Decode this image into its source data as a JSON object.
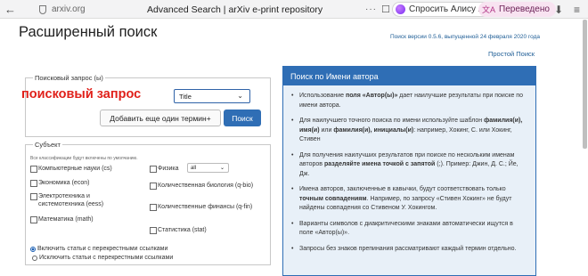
{
  "browser": {
    "back": "←",
    "url": "arxiv.org",
    "title": "Advanced Search | arXiv e-print repository",
    "dots": "···",
    "bookmark": "☐",
    "alice": "Спросить Алису AI",
    "translated": "Переведено",
    "download": "⬇",
    "menu": "≡"
  },
  "page": {
    "title": "Расширенный поиск",
    "version": "Поиск версии 0.5.6, выпущенной 24 февраля 2020 года",
    "simple_link": "Простой Поиск"
  },
  "query": {
    "legend": "Поисковый запрос (ы)",
    "annotation": "поисковый запрос",
    "field_value": "Title",
    "add_term": "Добавить еще один термин+",
    "search": "Поиск"
  },
  "subject": {
    "legend": "Субъект",
    "note": "Все классификации будут включены по умолчанию.",
    "cs": "Компьютерные науки (cs)",
    "econ": "Экономика (econ)",
    "eess": "Электротехника и системотехника (eess)",
    "math": "Математика (math)",
    "physics": "Физика",
    "physics_select": "all",
    "qbio": "Количественная биология (q-bio)",
    "qfin": "Количественные финансы (q-fin)",
    "stat": "Статистика (stat)",
    "radio_include": "Включить статьи с перекрестными ссылками",
    "radio_exclude": "Исключить статьи с перекрестными ссылками"
  },
  "help": {
    "header": "Поиск по Имени автора",
    "items": [
      {
        "pre": "Использование ",
        "b1": "поля «Автор(ы)»",
        "mid": " дает наилучшие результаты при поиске по имени автора.",
        "b2": "",
        "post": ""
      },
      {
        "pre": "Для наилучшего точного поиска по имени используйте шаблон ",
        "b1": "фамилия(и), имя(и)",
        "mid": " или ",
        "b2": "фамилия(и), инициалы(и)",
        "post": ": например, Хокинг, С. или Хокинг, Стивен"
      },
      {
        "pre": "Для получения наилучших результатов при поиске по нескольким именам авторов ",
        "b1": "разделяйте имена точкой с запятой",
        "mid": " (;). Пример: Джин, Д. С.; Йе, Дж.",
        "b2": "",
        "post": ""
      },
      {
        "pre": "Имена авторов, заключенные в кавычки, будут соответствовать только ",
        "b1": "точным совпадениям",
        "mid": ". Например, по запросу «Стивен Хокинг» не будут найдены совпадения со Стивеном У. Хокингом.",
        "b2": "",
        "post": ""
      },
      {
        "pre": "Варианты символов с диакритическими знаками автоматически ищутся в поле «Автор(ы)».",
        "b1": "",
        "mid": "",
        "b2": "",
        "post": ""
      },
      {
        "pre": "Запросы без знаков препинания рассматривают каждый термин отдельно.",
        "b1": "",
        "mid": "",
        "b2": "",
        "post": ""
      }
    ]
  }
}
